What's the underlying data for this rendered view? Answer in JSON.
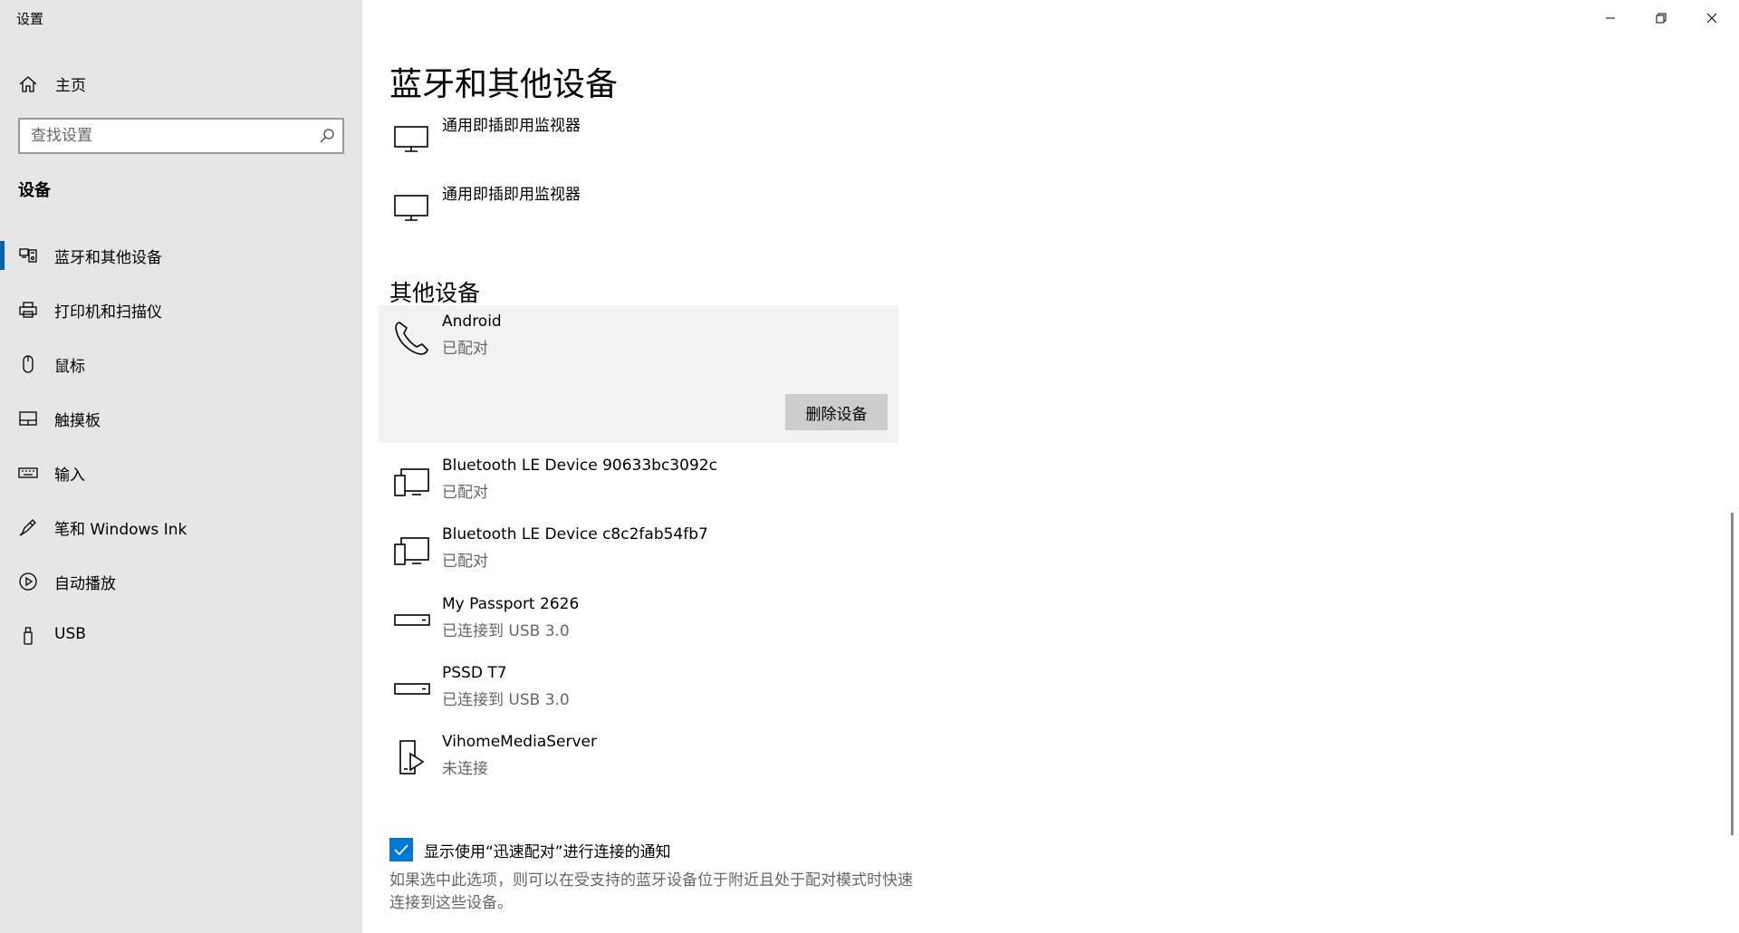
{
  "window": {
    "title": "设置",
    "minimize_icon": "minimize-icon",
    "restore_icon": "restore-icon",
    "close_icon": "close-icon"
  },
  "sidebar": {
    "home_label": "主页",
    "search_placeholder": "查找设置",
    "section": "设备",
    "items": [
      {
        "label": "蓝牙和其他设备",
        "icon": "bluetooth-devices-icon",
        "active": true
      },
      {
        "label": "打印机和扫描仪",
        "icon": "printer-icon"
      },
      {
        "label": "鼠标",
        "icon": "mouse-icon"
      },
      {
        "label": "触摸板",
        "icon": "touchpad-icon"
      },
      {
        "label": "输入",
        "icon": "keyboard-icon"
      },
      {
        "label": "笔和 Windows Ink",
        "icon": "pen-icon"
      },
      {
        "label": "自动播放",
        "icon": "autoplay-icon"
      },
      {
        "label": "USB",
        "icon": "usb-icon"
      }
    ]
  },
  "main": {
    "title": "蓝牙和其他设备",
    "monitors": [
      {
        "name": "通用即插即用监视器",
        "icon": "monitor-icon"
      },
      {
        "name": "通用即插即用监视器",
        "icon": "monitor-icon"
      }
    ],
    "other_devices_title": "其他设备",
    "devices": [
      {
        "name": "Android",
        "status": "已配对",
        "icon": "phone-icon",
        "selected": true
      },
      {
        "name": "Bluetooth LE Device 90633bc3092c",
        "status": "已配对",
        "icon": "device-generic-icon"
      },
      {
        "name": "Bluetooth LE Device c8c2fab54fb7",
        "status": "已配对",
        "icon": "device-generic-icon"
      },
      {
        "name": "My Passport 2626",
        "status": "已连接到 USB 3.0",
        "icon": "drive-icon"
      },
      {
        "name": "PSSD T7",
        "status": "已连接到 USB 3.0",
        "icon": "drive-icon"
      },
      {
        "name": "VihomeMediaServer",
        "status": "未连接",
        "icon": "media-server-icon"
      }
    ],
    "remove_button": "删除设备",
    "swift_pair": {
      "label": "显示使用“迅速配对”进行连接的通知",
      "checked": true,
      "description": "如果选中此选项，则可以在受支持的蓝牙设备位于附近且处于配对模式时快速连接到这些设备。"
    }
  },
  "colors": {
    "sidebar_bg": "#e6e6e6",
    "accent": "#0078d7",
    "active_indicator": "#0063b1",
    "selected_bg": "#f2f2f2",
    "button_bg": "#cccccc"
  }
}
